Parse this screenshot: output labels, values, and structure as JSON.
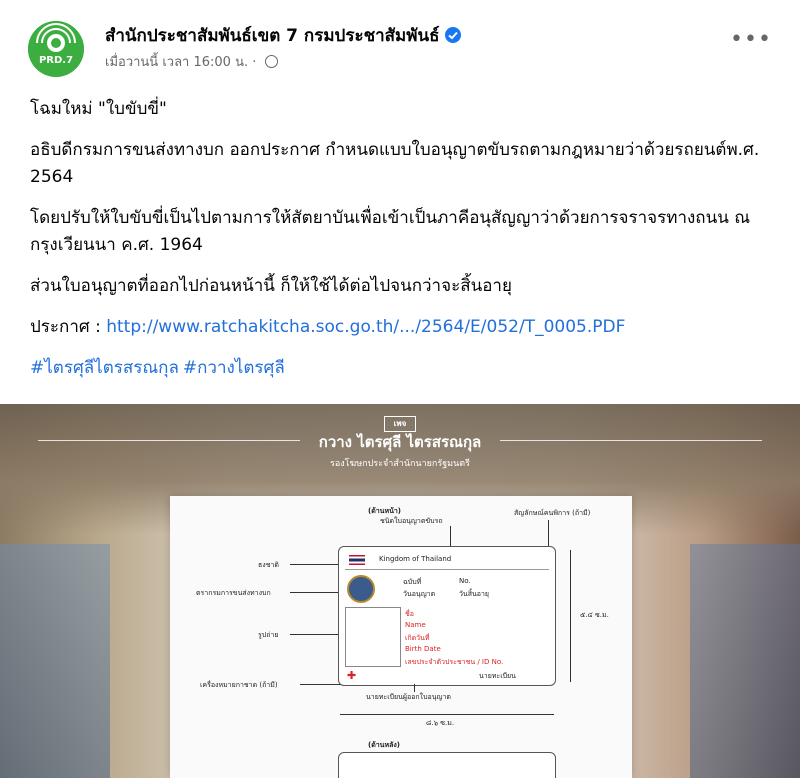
{
  "post": {
    "page_name": "สำนักประชาสัมพันธ์เขต 7 กรมประชาสัมพันธ์",
    "timestamp": "เมื่อวานนี้ เวลา 16:00 น. ·",
    "avatar_text": "PRD.7",
    "more_label": "•••",
    "verified_icon": "verified-badge-icon",
    "privacy_icon": "globe-icon"
  },
  "body": {
    "p1": "โฉมใหม่ \"ใบขับขี่\"",
    "p2": "อธิบดีกรมการขนส่งทางบก ออกประกาศ กำหนดแบบใบอนุญาตขับรถตามกฎหมายว่าด้วยรถยนต์พ.ศ. 2564",
    "p3": "โดยปรับให้ใบขับขี่เป็นไปตามการให้สัตยาบันเพื่อเข้าเป็นภาคีอนุสัญญาว่าด้วยการจราจรทางถนน ณ กรุงเวียนนา ค.ศ. 1964",
    "p4": "ส่วนใบอนุญาตที่ออกไปก่อนหน้านี้  ก็ให้ใช้ได้ต่อไปจนกว่าจะสิ้นอายุ",
    "p5_label": "ประกาศ : ",
    "p5_link": "http://www.ratchakitcha.soc.go.th/.../2564/E/052/T_0005.PDF",
    "hashtags": [
      "#ไตรศุลีไตรสรณกุล",
      "#กวางไตรศุลี"
    ]
  },
  "image": {
    "badge": "เพจ",
    "title": "กวาง ไตรศุลี ไตรสรณกุล",
    "subtitle": "รองโฆษกประจำสำนักนายกรัฐมนตรี",
    "front_label": "(ด้านหน้า)",
    "type_label": "ชนิดใบอนุญาตขับรถ",
    "disability_label": "สัญลักษณ์คนพิการ (ถ้ามี)",
    "flag_label": "ธงชาติ",
    "seal_label": "ตรากรมการขนส่งทางบก",
    "photo_label": "รูปถ่าย",
    "redcross_label": "เครื่องหมายกาชาด (ถ้ามี)",
    "registrar_label": "นายทะเบียนผู้ออกใบอนุญาต",
    "height_label": "๕.๔ ซ.ม.",
    "width_label": "๘.๖ ซ.ม.",
    "back_label": "(ด้านหลัง)",
    "card_header": "Kingdom of Thailand",
    "card_fields": [
      "ฉบับที่",
      "No.",
      "วันอนุญาต",
      "วันสิ้นอายุ",
      "ชื่อ",
      "Name",
      "เกิดวันที่",
      "Birth Date",
      "เลขประจำตัวประชาชน / ID No."
    ],
    "card_footer": "นายทะเบียน"
  }
}
